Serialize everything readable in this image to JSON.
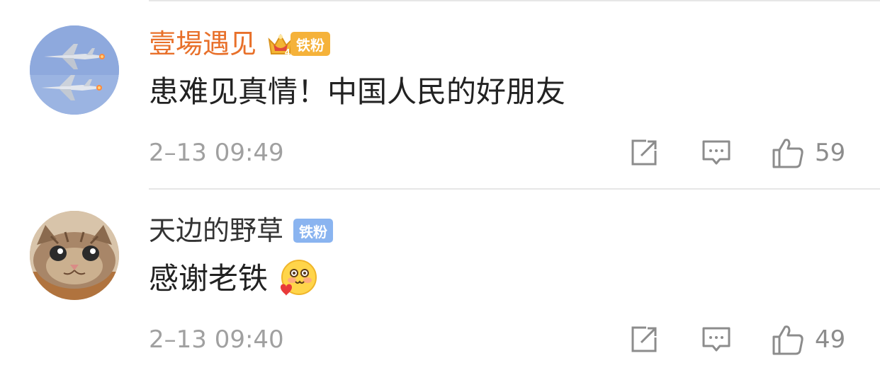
{
  "comments": [
    {
      "username": "壹場遇见",
      "username_color": "#e8702a",
      "crown_level": "4",
      "fan_label": "铁粉",
      "fan_badge_color": "#f5a623",
      "text": "患难见真情！中国人民的好朋友",
      "timestamp": "2–13 09:49",
      "likes": "59",
      "avatar_icon": "fighter-jets-avatar"
    },
    {
      "username": "天边的野草",
      "username_color": "#333333",
      "fan_label": "铁粉",
      "fan_badge_color": "#8ab4f0",
      "text": "感谢老铁",
      "emoji": "blushing-face-with-heart",
      "timestamp": "2–13 09:40",
      "likes": "49",
      "avatar_icon": "cat-avatar"
    }
  ],
  "icons": {
    "share": "share-icon",
    "reply": "reply-icon",
    "like": "thumbs-up-icon"
  }
}
